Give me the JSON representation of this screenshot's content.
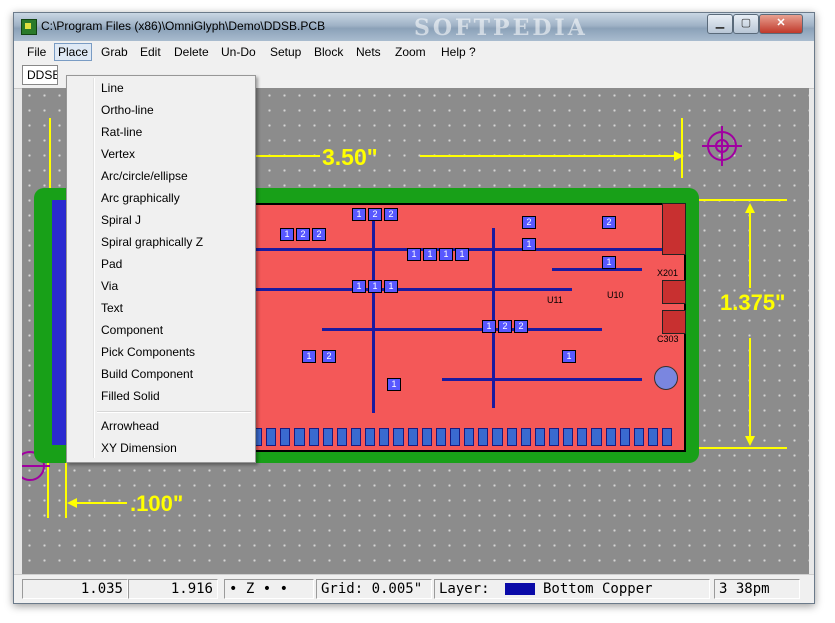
{
  "window": {
    "title": "C:\\Program Files (x86)\\OmniGlyph\\Demo\\DDSB.PCB",
    "watermark": "SOFTPEDIA"
  },
  "menubar": {
    "items": [
      "File",
      "Place",
      "Grab",
      "Edit",
      "Delete",
      "Un-Do",
      "Setup",
      "Block",
      "Nets",
      "Zoom",
      "Help ?"
    ],
    "active": "Place"
  },
  "toolbar": {
    "doc_label": "DDSB"
  },
  "place_menu": {
    "items": [
      "Line",
      "Ortho-line",
      "Rat-line",
      "Vertex",
      "Arc/circle/ellipse",
      "Arc graphically",
      "Spiral J",
      "Spiral graphically Z",
      "Pad",
      "Via",
      "Text",
      "Component",
      "Pick Components",
      "Build Component",
      "Filled Solid"
    ],
    "extra_items": [
      "Arrowhead",
      "XY Dimension"
    ]
  },
  "canvas": {
    "dimension_width": "3.50\"",
    "dimension_height": "1.375\"",
    "dimension_offset": ".100\"",
    "labels": [
      "X201",
      "C303",
      "U11",
      "U10"
    ]
  },
  "statusbar": {
    "x": "1.035",
    "y": "1.916",
    "mode": "• Z • •",
    "grid": "Grid: 0.005\"",
    "layer_label": "Layer:",
    "layer_name": "Bottom Copper",
    "time": "3 38pm"
  },
  "colors": {
    "board_green": "#18a018",
    "copper_red": "#f45858",
    "bottom_copper": "#0a0aa8",
    "dimension": "#ffff00",
    "target": "#a000a0"
  }
}
